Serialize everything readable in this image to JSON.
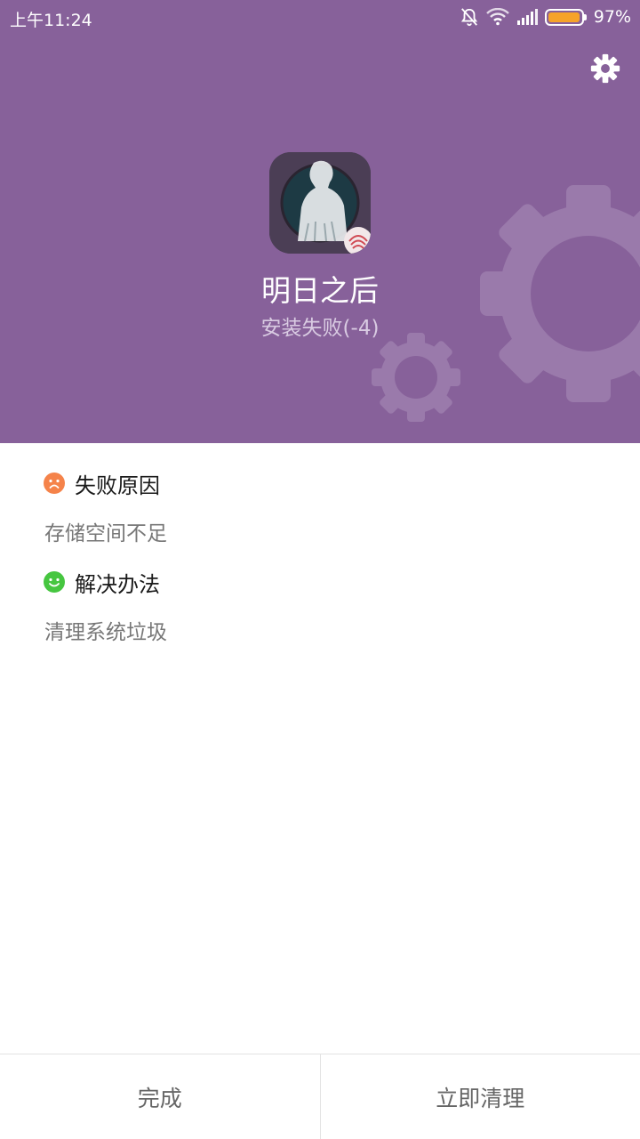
{
  "status_bar": {
    "time": "上午11:24",
    "battery_percent": "97%",
    "battery_level": 0.97,
    "icons": [
      "bell-off-icon",
      "wifi-icon",
      "signal-icon",
      "battery-icon"
    ]
  },
  "header": {
    "background_color": "#87619a",
    "settings_icon": "gear-icon",
    "app_name": "明日之后",
    "app_status": "安装失败(-4)"
  },
  "sections": {
    "failure": {
      "icon": "sad-face-icon",
      "icon_color": "#f5834a",
      "title": "失败原因",
      "text": "存储空间不足"
    },
    "solution": {
      "icon": "smile-face-icon",
      "icon_color": "#46c640",
      "title": "解决办法",
      "text": "清理系统垃圾"
    }
  },
  "footer": {
    "done_label": "完成",
    "clean_label": "立即清理"
  }
}
